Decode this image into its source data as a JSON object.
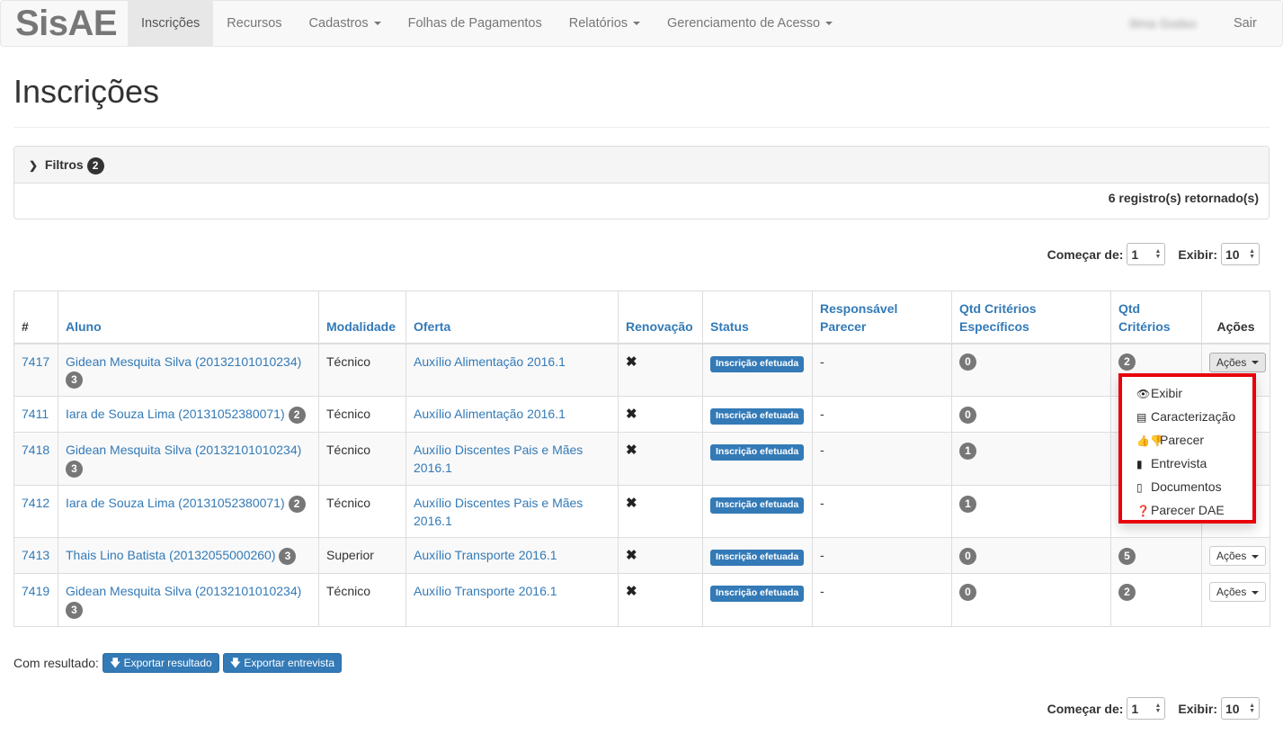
{
  "navbar": {
    "brand": "SisAE",
    "items": [
      {
        "label": "Inscrições",
        "active": true,
        "dropdown": false
      },
      {
        "label": "Recursos",
        "active": false,
        "dropdown": false
      },
      {
        "label": "Cadastros",
        "active": false,
        "dropdown": true
      },
      {
        "label": "Folhas de Pagamentos",
        "active": false,
        "dropdown": false
      },
      {
        "label": "Relatórios",
        "active": false,
        "dropdown": true
      },
      {
        "label": "Gerenciamento de Acesso",
        "active": false,
        "dropdown": true
      }
    ],
    "user": "Ilima Godso",
    "logout": "Sair"
  },
  "page": {
    "title": "Inscrições"
  },
  "filters": {
    "label": "Filtros",
    "count": "2",
    "records": "6 registro(s) retornado(s)"
  },
  "pager": {
    "start_label": "Começar de:",
    "start_value": "1",
    "show_label": "Exibir:",
    "show_value": "10"
  },
  "table": {
    "headers": [
      "#",
      "Aluno",
      "Modalidade",
      "Oferta",
      "Renovação",
      "Status",
      "Responsável Parecer",
      "Qtd Critérios Específicos",
      "Qtd Critérios",
      "Ações"
    ],
    "rows": [
      {
        "id": "7417",
        "aluno": "Gidean Mesquita Silva (20132101010234)",
        "aluno_badge": "3",
        "modalidade": "Técnico",
        "oferta": "Auxílio Alimentação 2016.1",
        "renovacao": "✖",
        "status": "Inscrição efetuada",
        "responsavel": "-",
        "qtd_especificos": "0",
        "qtd_criterios": "2",
        "acoes": "Ações"
      },
      {
        "id": "7411",
        "aluno": "Iara de Souza Lima (20131052380071)",
        "aluno_badge": "2",
        "modalidade": "Técnico",
        "oferta": "Auxílio Alimentação 2016.1",
        "renovacao": "✖",
        "status": "Inscrição efetuada",
        "responsavel": "-",
        "qtd_especificos": "0",
        "qtd_criterios": "",
        "acoes": ""
      },
      {
        "id": "7418",
        "aluno": "Gidean Mesquita Silva (20132101010234)",
        "aluno_badge": "3",
        "modalidade": "Técnico",
        "oferta": "Auxílio Discentes Pais e Mães 2016.1",
        "renovacao": "✖",
        "status": "Inscrição efetuada",
        "responsavel": "-",
        "qtd_especificos": "1",
        "qtd_criterios": "",
        "acoes": ""
      },
      {
        "id": "7412",
        "aluno": "Iara de Souza Lima (20131052380071)",
        "aluno_badge": "2",
        "modalidade": "Técnico",
        "oferta": "Auxílio Discentes Pais e Mães 2016.1",
        "renovacao": "✖",
        "status": "Inscrição efetuada",
        "responsavel": "-",
        "qtd_especificos": "1",
        "qtd_criterios": "",
        "acoes": ""
      },
      {
        "id": "7413",
        "aluno": "Thais Lino Batista (20132055000260)",
        "aluno_badge": "3",
        "modalidade": "Superior",
        "oferta": "Auxílio Transporte 2016.1",
        "renovacao": "✖",
        "status": "Inscrição efetuada",
        "responsavel": "-",
        "qtd_especificos": "0",
        "qtd_criterios": "5",
        "acoes": "Ações"
      },
      {
        "id": "7419",
        "aluno": "Gidean Mesquita Silva (20132101010234)",
        "aluno_badge": "3",
        "modalidade": "Técnico",
        "oferta": "Auxílio Transporte 2016.1",
        "renovacao": "✖",
        "status": "Inscrição efetuada",
        "responsavel": "-",
        "qtd_especificos": "0",
        "qtd_criterios": "2",
        "acoes": "Ações"
      }
    ]
  },
  "dropdown": {
    "items": [
      {
        "label": "Exibir",
        "icon": "eye-icon"
      },
      {
        "label": "Caracterização",
        "icon": "list-icon"
      },
      {
        "label": "Parecer",
        "icon": "thumbs-icon"
      },
      {
        "label": "Entrevista",
        "icon": "book-icon"
      },
      {
        "label": "Documentos",
        "icon": "file-icon"
      },
      {
        "label": "Parecer DAE",
        "icon": "question-icon"
      }
    ]
  },
  "export": {
    "label": "Com resultado:",
    "btn_resultado": "Exportar resultado",
    "btn_entrevista": "Exportar entrevista"
  },
  "colors": {
    "link": "#337ab7",
    "highlight": "#e8000b",
    "badge": "#777777"
  }
}
